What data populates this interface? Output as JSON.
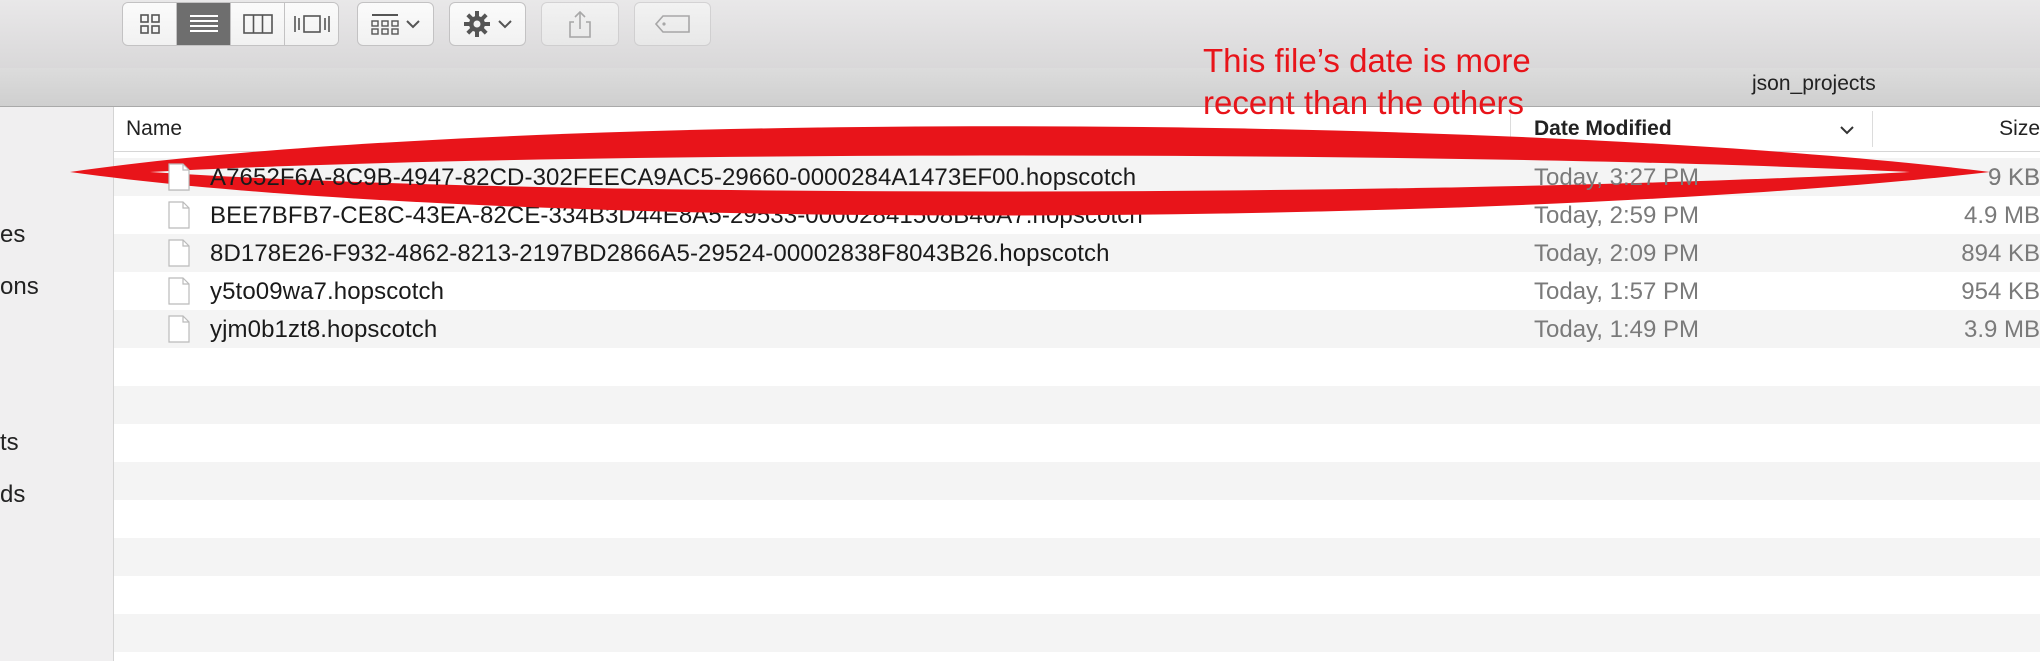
{
  "toolbar": {
    "view_buttons": [
      "icon-view",
      "list-view",
      "column-view",
      "cover-flow-view"
    ],
    "active_view": "list-view",
    "arrange_icon": "arrange-icon",
    "action_icon": "gear-icon",
    "share_icon": "share-icon",
    "tag_icon": "tag-icon"
  },
  "pathbar": {
    "title": "json_projects"
  },
  "sidebar": {
    "items": [
      {
        "label": "es"
      },
      {
        "label": "ons"
      },
      {
        "label": "ts"
      },
      {
        "label": "ds"
      }
    ]
  },
  "columns": {
    "name": "Name",
    "date_modified": "Date Modified",
    "size": "Size"
  },
  "files": [
    {
      "name": "A7652F6A-8C9B-4947-82CD-302FEECA9AC5-29660-0000284A1473EF00.hopscotch",
      "date": "Today, 3:27 PM",
      "size": "9 KB"
    },
    {
      "name": "BEE7BFB7-CE8C-43EA-82CE-334B3D44E8A5-29533-00002841508B46A7.hopscotch",
      "date": "Today, 2:59 PM",
      "size": "4.9 MB"
    },
    {
      "name": "8D178E26-F932-4862-8213-2197BD2866A5-29524-00002838F8043B26.hopscotch",
      "date": "Today, 2:09 PM",
      "size": "894 KB"
    },
    {
      "name": "y5to09wa7.hopscotch",
      "date": "Today, 1:57 PM",
      "size": "954 KB"
    },
    {
      "name": "yjm0b1zt8.hopscotch",
      "date": "Today, 1:49 PM",
      "size": "3.9 MB"
    }
  ],
  "annotation": {
    "line1": "This file’s date is more",
    "line2": "recent than the others",
    "color": "#e8141a"
  }
}
